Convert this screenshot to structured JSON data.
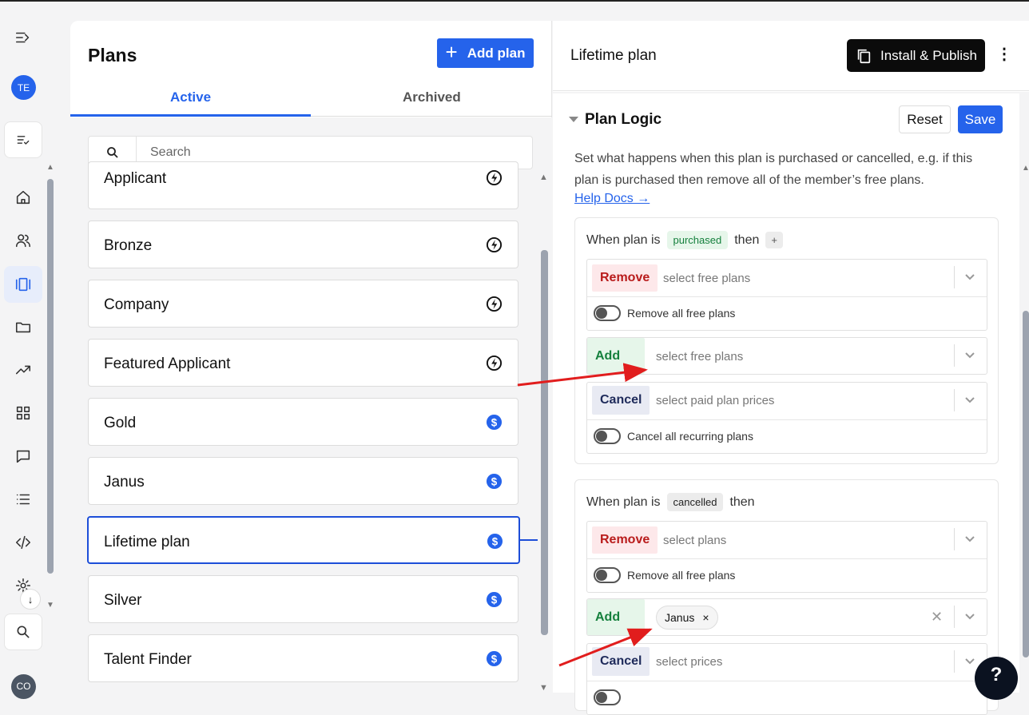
{
  "rail": {
    "avatar_initials": "TE",
    "bottom_avatar_initials": "CO"
  },
  "plans_panel": {
    "title": "Plans",
    "add_plan_label": "Add plan",
    "tabs": [
      {
        "label": "Active"
      },
      {
        "label": "Archived"
      }
    ],
    "search_placeholder": "Search",
    "items": [
      {
        "name": "Applicant",
        "type": "free"
      },
      {
        "name": "Bronze",
        "type": "free"
      },
      {
        "name": "Company",
        "type": "free"
      },
      {
        "name": "Featured Applicant",
        "type": "free"
      },
      {
        "name": "Gold",
        "type": "paid"
      },
      {
        "name": "Janus",
        "type": "paid"
      },
      {
        "name": "Lifetime plan",
        "type": "paid",
        "selected": true
      },
      {
        "name": "Silver",
        "type": "paid"
      },
      {
        "name": "Talent Finder",
        "type": "paid"
      }
    ]
  },
  "detail": {
    "title": "Lifetime plan",
    "publish_label": "Install & Publish",
    "section_title": "Plan Logic",
    "reset_label": "Reset",
    "save_label": "Save",
    "description": "Set what happens when this plan is purchased or cancelled, e.g. if this plan is purchased then remove all of the member’s free plans.",
    "help_link": "Help Docs →",
    "purchased": {
      "prefix": "When plan is",
      "status": "purchased",
      "suffix": "then",
      "plus": "+",
      "remove_label": "Remove",
      "remove_placeholder": "select free plans",
      "remove_toggle_label": "Remove all free plans",
      "add_label": "Add",
      "add_placeholder": "select free plans",
      "cancel_label": "Cancel",
      "cancel_placeholder": "select paid plan prices",
      "cancel_toggle_label": "Cancel all recurring plans"
    },
    "cancelled": {
      "prefix": "When plan is",
      "status": "cancelled",
      "suffix": "then",
      "remove_label": "Remove",
      "remove_placeholder": "select plans",
      "remove_toggle_label": "Remove all free plans",
      "add_label": "Add",
      "add_chip": "Janus",
      "cancel_label": "Cancel",
      "cancel_placeholder": "select prices"
    }
  },
  "help_fab": "?",
  "colors": {
    "accent": "#2563eb",
    "annotation_arrow": "#e11d1d",
    "remove": "#b91c1c",
    "add": "#15803d"
  }
}
